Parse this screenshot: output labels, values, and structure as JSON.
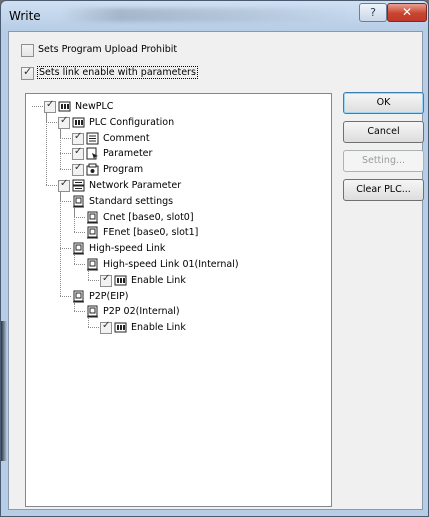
{
  "window": {
    "title": "Write"
  },
  "options": {
    "upload_prohibit": {
      "label": "Sets Program Upload Prohibit",
      "checked": false
    },
    "link_enable": {
      "label": "Sets link enable with parameters",
      "checked": true
    }
  },
  "tree": {
    "items": [
      {
        "label": "NewPLC",
        "icon": "plc-icon",
        "checkbox": true
      },
      {
        "label": "PLC Configuration",
        "icon": "plc-config-icon",
        "checkbox": true
      },
      {
        "label": "Comment",
        "icon": "comment-icon",
        "checkbox": true
      },
      {
        "label": "Parameter",
        "icon": "parameter-icon",
        "checkbox": true
      },
      {
        "label": "Program",
        "icon": "program-icon",
        "checkbox": true
      },
      {
        "label": "Network Parameter",
        "icon": "network-icon",
        "checkbox": true
      },
      {
        "label": "Standard settings",
        "icon": "module-icon",
        "checkbox": false
      },
      {
        "label": "Cnet [base0, slot0]",
        "icon": "module-icon",
        "checkbox": false
      },
      {
        "label": "FEnet [base0, slot1]",
        "icon": "module-icon",
        "checkbox": false
      },
      {
        "label": "High-speed Link",
        "icon": "module-icon",
        "checkbox": false
      },
      {
        "label": "High-speed Link 01(Internal)",
        "icon": "module-icon",
        "checkbox": false
      },
      {
        "label": "Enable Link",
        "icon": "plc-icon",
        "checkbox": true
      },
      {
        "label": "P2P(EIP)",
        "icon": "module-icon",
        "checkbox": false
      },
      {
        "label": "P2P 02(Internal)",
        "icon": "module-icon",
        "checkbox": false
      },
      {
        "label": "Enable Link",
        "icon": "plc-icon",
        "checkbox": true
      }
    ]
  },
  "buttons": {
    "ok": "OK",
    "cancel": "Cancel",
    "setting": "Setting...",
    "clear_plc": "Clear PLC..."
  }
}
